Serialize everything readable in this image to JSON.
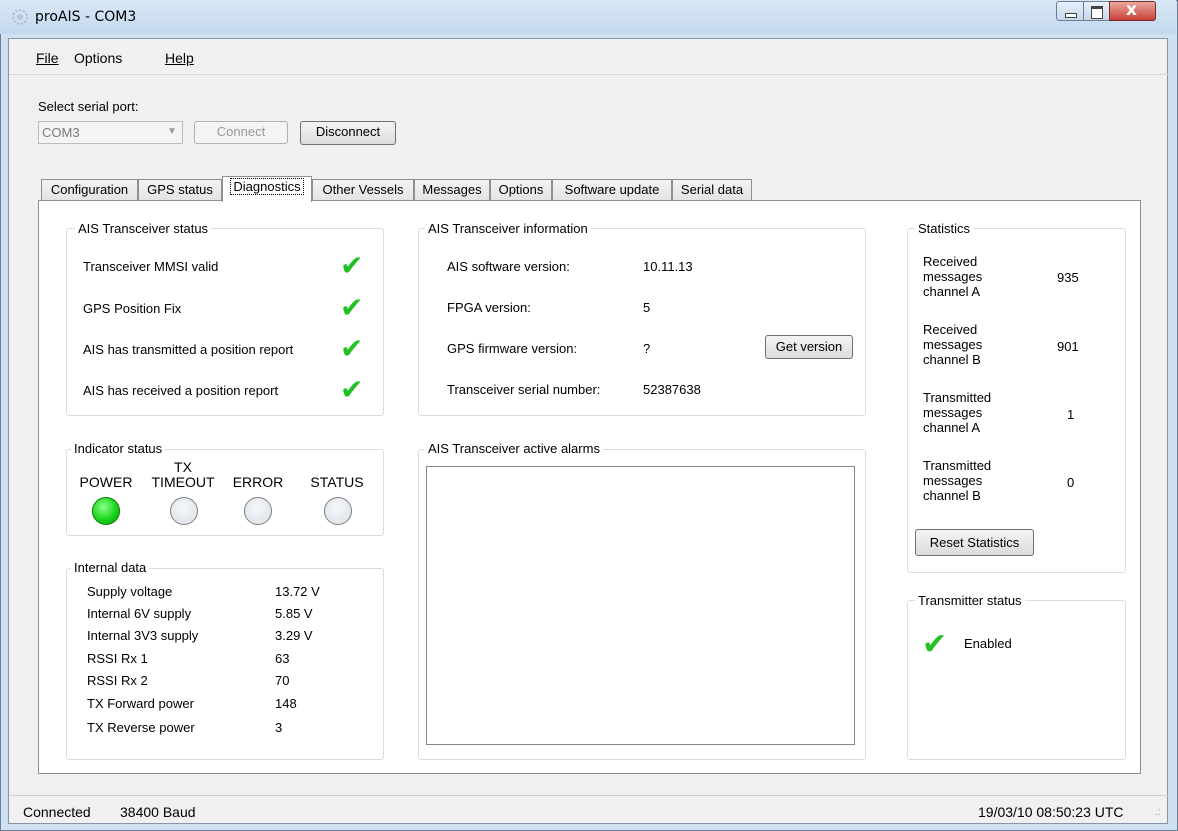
{
  "window": {
    "title": "proAIS - COM3"
  },
  "menu": {
    "file": "File",
    "options": "Options",
    "help": "Help"
  },
  "serial": {
    "label": "Select serial port:",
    "port": "COM3",
    "connect": "Connect",
    "disconnect": "Disconnect"
  },
  "tabs": [
    "Configuration",
    "GPS status",
    "Diagnostics",
    "Other Vessels",
    "Messages",
    "Options",
    "Software update",
    "Serial data"
  ],
  "transceiver_status": {
    "title": "AIS Transceiver status",
    "items": [
      "Transceiver MMSI valid",
      "GPS Position Fix",
      "AIS has transmitted a position report",
      "AIS has received a position report"
    ]
  },
  "indicator": {
    "title": "Indicator status",
    "power": "POWER",
    "tx_timeout_1": "TX",
    "tx_timeout_2": "TIMEOUT",
    "error": "ERROR",
    "status": "STATUS",
    "power_on": true
  },
  "internal": {
    "title": "Internal data",
    "rows": [
      {
        "label": "Supply voltage",
        "value": "13.72 V"
      },
      {
        "label": "Internal 6V supply",
        "value": "5.85 V"
      },
      {
        "label": "Internal 3V3 supply",
        "value": "3.29 V"
      },
      {
        "label": "RSSI Rx 1",
        "value": "63"
      },
      {
        "label": "RSSI Rx 2",
        "value": "70"
      },
      {
        "label": "TX Forward power",
        "value": "148"
      },
      {
        "label": "TX Reverse power",
        "value": "3"
      }
    ]
  },
  "info": {
    "title": "AIS Transceiver information",
    "rows": [
      {
        "label": "AIS software version:",
        "value": "10.11.13"
      },
      {
        "label": "FPGA version:",
        "value": "5"
      },
      {
        "label": "GPS firmware version:",
        "value": "?"
      },
      {
        "label": "Transceiver serial number:",
        "value": "52387638"
      }
    ],
    "get_version": "Get version"
  },
  "alarms": {
    "title": "AIS Transceiver active alarms"
  },
  "statistics": {
    "title": "Statistics",
    "rows": [
      {
        "l1": "Received",
        "l2": "messages",
        "l3": "channel A",
        "value": "935"
      },
      {
        "l1": "Received",
        "l2": "messages",
        "l3": "channel B",
        "value": "901"
      },
      {
        "l1": "Transmitted",
        "l2": "messages",
        "l3": "channel A",
        "value": "1"
      },
      {
        "l1": "Transmitted",
        "l2": "messages",
        "l3": "channel B",
        "value": "0"
      }
    ],
    "reset": "Reset Statistics"
  },
  "transmitter": {
    "title": "Transmitter status",
    "state": "Enabled"
  },
  "statusbar": {
    "connected": "Connected",
    "baud": "38400 Baud",
    "time": "19/03/10 08:50:23 UTC"
  },
  "colors": {
    "check": "#22c022",
    "led_on": "#19d619",
    "close_button": "#c9423a"
  },
  "icons": [
    "app-icon",
    "minimize-icon",
    "maximize-icon",
    "close-icon",
    "dropdown-arrow-icon",
    "checkmark-icon",
    "size-grip-icon"
  ]
}
